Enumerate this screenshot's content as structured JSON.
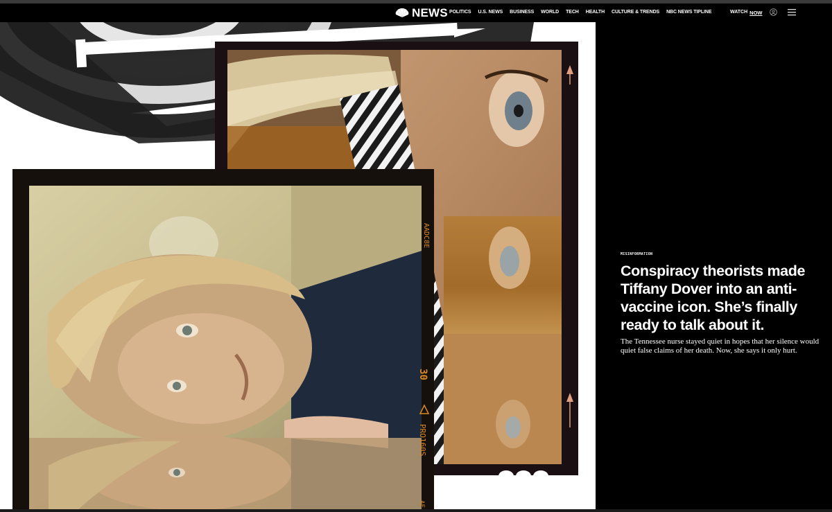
{
  "header": {
    "logo_text": "NEWS",
    "nav": [
      "POLITICS",
      "U.S. NEWS",
      "BUSINESS",
      "WORLD",
      "TECH",
      "HEALTH",
      "CULTURE & TRENDS",
      "NBC NEWS TIPLINE"
    ],
    "watch_label": "WATCH",
    "watch_now": "NOW"
  },
  "hero": {
    "film_edge_top": "AADC8E",
    "film_edge_number": "30",
    "film_edge_code": "PRO160S",
    "film_edge_bottom": "AF"
  },
  "article": {
    "kicker": "MISINFORMATION",
    "headline": "Conspiracy theorists made Tiffany Dover into an anti-vaccine icon. She’s finally ready to talk about it.",
    "dek": "The Tennessee nurse stayed quiet in hopes that her silence would quiet false claims of her death. Now, she says it only hurt."
  },
  "colors": {
    "background": "#000000",
    "text": "#ffffff",
    "film_edge": "#d98a22"
  }
}
